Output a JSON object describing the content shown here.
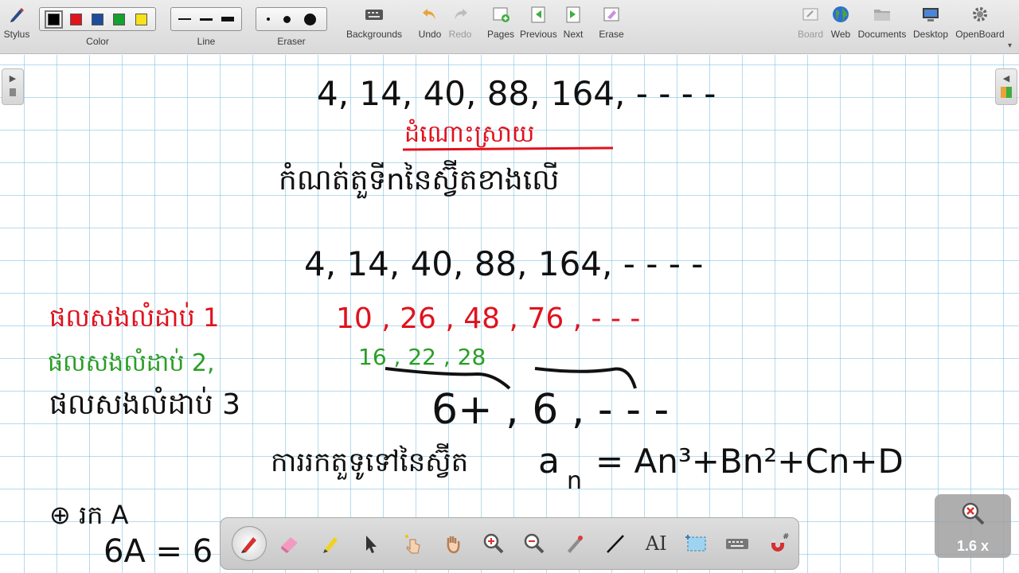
{
  "toolbar": {
    "stylus": "Stylus",
    "color": "Color",
    "line": "Line",
    "eraser": "Eraser",
    "backgrounds": "Backgrounds",
    "undo": "Undo",
    "redo": "Redo",
    "pages": "Pages",
    "previous": "Previous",
    "next": "Next",
    "erase": "Erase",
    "board": "Board",
    "web": "Web",
    "documents": "Documents",
    "desktop": "Desktop",
    "openboard": "OpenBoard"
  },
  "colors": {
    "swatches": [
      "#000000",
      "#e0141b",
      "#1f4c9b",
      "#15a12d",
      "#f5e21b"
    ],
    "ink_black": "#111111",
    "ink_red": "#e0121e",
    "ink_green": "#2a9e24",
    "grid": "#78bee1"
  },
  "board": {
    "line1": "4, 14, 40, 88, 164, - - - -",
    "khmer_heading": "ដំណោះស្រាយ",
    "khmer_task": "កំណត់តួទីnនៃស្វ៊ីតខាងលើ",
    "line2": "4, 14, 40, 88, 164, - - - -",
    "diff1_label": "ផលសងលំដាប់ 1",
    "diff1_values": "10 , 26 , 48 , 76 , - - -",
    "diff2_label": "ផលសងលំដាប់ 2,",
    "diff2_values": "16 , 22 , 28",
    "diff3_label": "ផលសងលំដាប់ 3",
    "diff3_values": "6+ , 6 , - - -",
    "general_label": "ការរកតួទូទៅនៃស្វ៊ីត",
    "formula_a": "a",
    "formula_n": "n",
    "formula_rhs": "= An³+Bn²+Cn+D",
    "find_a": "⊕ រក A",
    "eq": "6A = 6"
  },
  "zoom": {
    "level": "1.6 x"
  },
  "palette": {
    "tools": [
      "pen-tool",
      "eraser-tool",
      "marker-tool",
      "selector-tool",
      "interactor-tool",
      "hand-tool",
      "zoom-in-tool",
      "zoom-out-tool",
      "laser-pointer-tool",
      "line-tool",
      "text-tool",
      "capture-tool",
      "virtual-keyboard-tool",
      "magnet-tool"
    ],
    "text_tool_label": "AI"
  }
}
